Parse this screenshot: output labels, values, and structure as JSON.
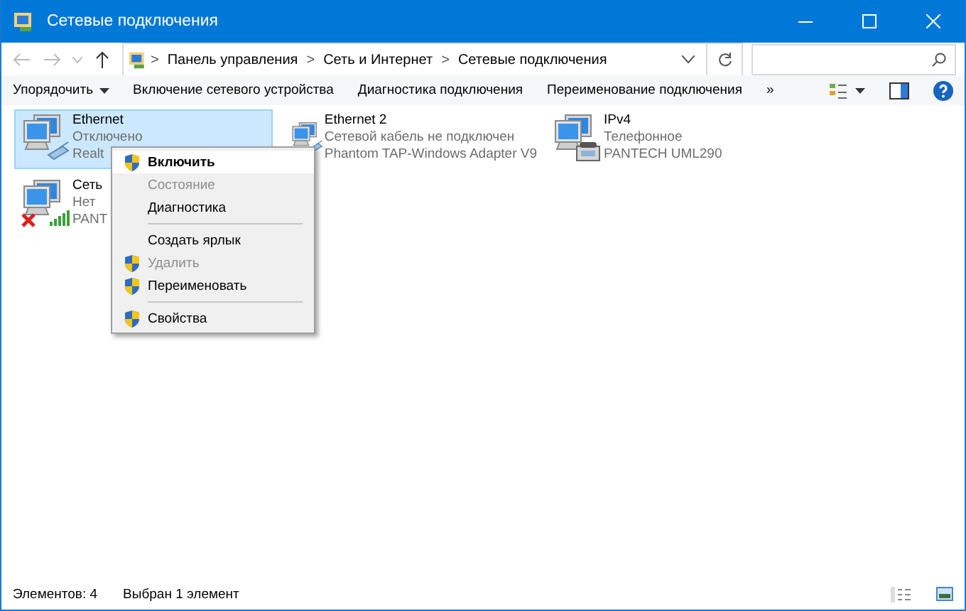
{
  "window": {
    "title": "Сетевые подключения"
  },
  "address": {
    "crumbs": [
      "Панель управления",
      "Сеть и Интернет",
      "Сетевые подключения"
    ],
    "separator": ">"
  },
  "toolbar": {
    "items": [
      {
        "label": "Упорядочить",
        "dropdown": true
      },
      {
        "label": "Включение сетевого устройства",
        "dropdown": false
      },
      {
        "label": "Диагностика подключения",
        "dropdown": false
      },
      {
        "label": "Переименование подключения",
        "dropdown": false
      }
    ],
    "more": "»"
  },
  "connections": [
    {
      "kind": "ethernet",
      "name": "Ethernet",
      "status": "Отключено",
      "device": "Realt",
      "selected": true
    },
    {
      "kind": "ethernet",
      "name": "Ethernet 2",
      "status": "Сетевой кабель не подключен",
      "device": "Phantom TAP-Windows Adapter V9",
      "selected": false
    },
    {
      "kind": "modem",
      "name": "IPv4",
      "status": "Телефонное",
      "device": "PANTECH UML290",
      "selected": false
    },
    {
      "kind": "wireless",
      "name": "Сеть",
      "status": "Нет",
      "device": "PANT",
      "selected": false
    }
  ],
  "context_menu": [
    {
      "kind": "item",
      "label": "Включить",
      "shield": true,
      "default": true,
      "disabled": false
    },
    {
      "kind": "item",
      "label": "Состояние",
      "shield": false,
      "default": false,
      "disabled": true
    },
    {
      "kind": "item",
      "label": "Диагностика",
      "shield": false,
      "default": false,
      "disabled": false
    },
    {
      "kind": "separator"
    },
    {
      "kind": "item",
      "label": "Создать ярлык",
      "shield": false,
      "default": false,
      "disabled": false
    },
    {
      "kind": "item",
      "label": "Удалить",
      "shield": true,
      "default": false,
      "disabled": true
    },
    {
      "kind": "item",
      "label": "Переименовать",
      "shield": true,
      "default": false,
      "disabled": false
    },
    {
      "kind": "separator"
    },
    {
      "kind": "item",
      "label": "Свойства",
      "shield": true,
      "default": false,
      "disabled": false
    }
  ],
  "status_bar": {
    "count": "Элементов: 4",
    "selection": "Выбран 1 элемент"
  }
}
